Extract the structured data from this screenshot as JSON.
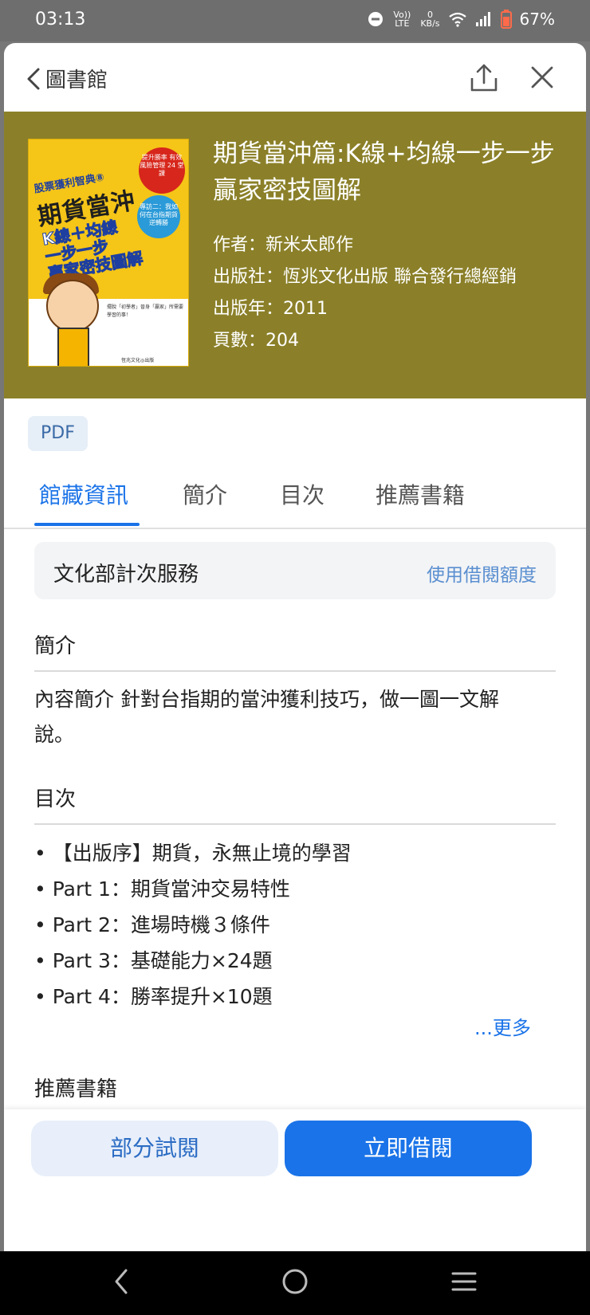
{
  "status_bar": {
    "time": "03:13",
    "volte": "Vo)) LTE",
    "net_speed_value": "0",
    "net_speed_unit": "KB/s",
    "battery": "67%"
  },
  "header": {
    "back_label": "圖書館"
  },
  "book": {
    "title": "期貨當沖篇:K線+均線一步一步贏家密技圖解",
    "author": "作者：新米太郎作",
    "publisher": "出版社：恆兆文化出版 聯合發行總經銷",
    "year": "出版年：2011",
    "pages": "頁數：204",
    "format": "PDF",
    "hero_color": "#8b8029",
    "cover": {
      "series": "股票獲利智典⑧",
      "title": "期貨當沖",
      "subtitle1": "K線＋均線",
      "subtitle2": "一步一步",
      "subtitle3": "贏家密技圖解",
      "badge1": "提升勝率 有效 風險管理 24 堂課",
      "badge2": "專訪二：我如何在台指期貨逆轉勝",
      "lead": "擺脫「初學者」晉身「贏家」所需要學習的事！",
      "publisher_mark": "恆兆文化◎出版"
    }
  },
  "tabs": [
    {
      "label": "館藏資訊",
      "active": true
    },
    {
      "label": "簡介",
      "active": false
    },
    {
      "label": "目次",
      "active": false
    },
    {
      "label": "推薦書籍",
      "active": false
    }
  ],
  "service": {
    "label": "文化部計次服務",
    "action": "使用借閱額度"
  },
  "sections": {
    "intro_heading": "簡介",
    "intro_text": "內容簡介 針對台指期的當沖獲利技巧，做一圖一文解說。",
    "toc_heading": "目次",
    "toc_items": [
      "• 【出版序】期貨，永無止境的學習",
      "• Part 1：期貨當沖交易特性",
      "• Part 2：進場時機３條件",
      "• Part 3：基礎能力×24題",
      "• Part 4：勝率提升×10題"
    ],
    "more_label": "...更多",
    "recommend_heading": "推薦書籍"
  },
  "actions": {
    "preview_label": "部分試閱",
    "borrow_label": "立即借閱",
    "accent_color": "#1a73e8"
  },
  "icons": [
    "back-chevron-icon",
    "share-icon",
    "close-icon",
    "nav-back-icon",
    "nav-home-icon",
    "nav-recents-icon"
  ]
}
